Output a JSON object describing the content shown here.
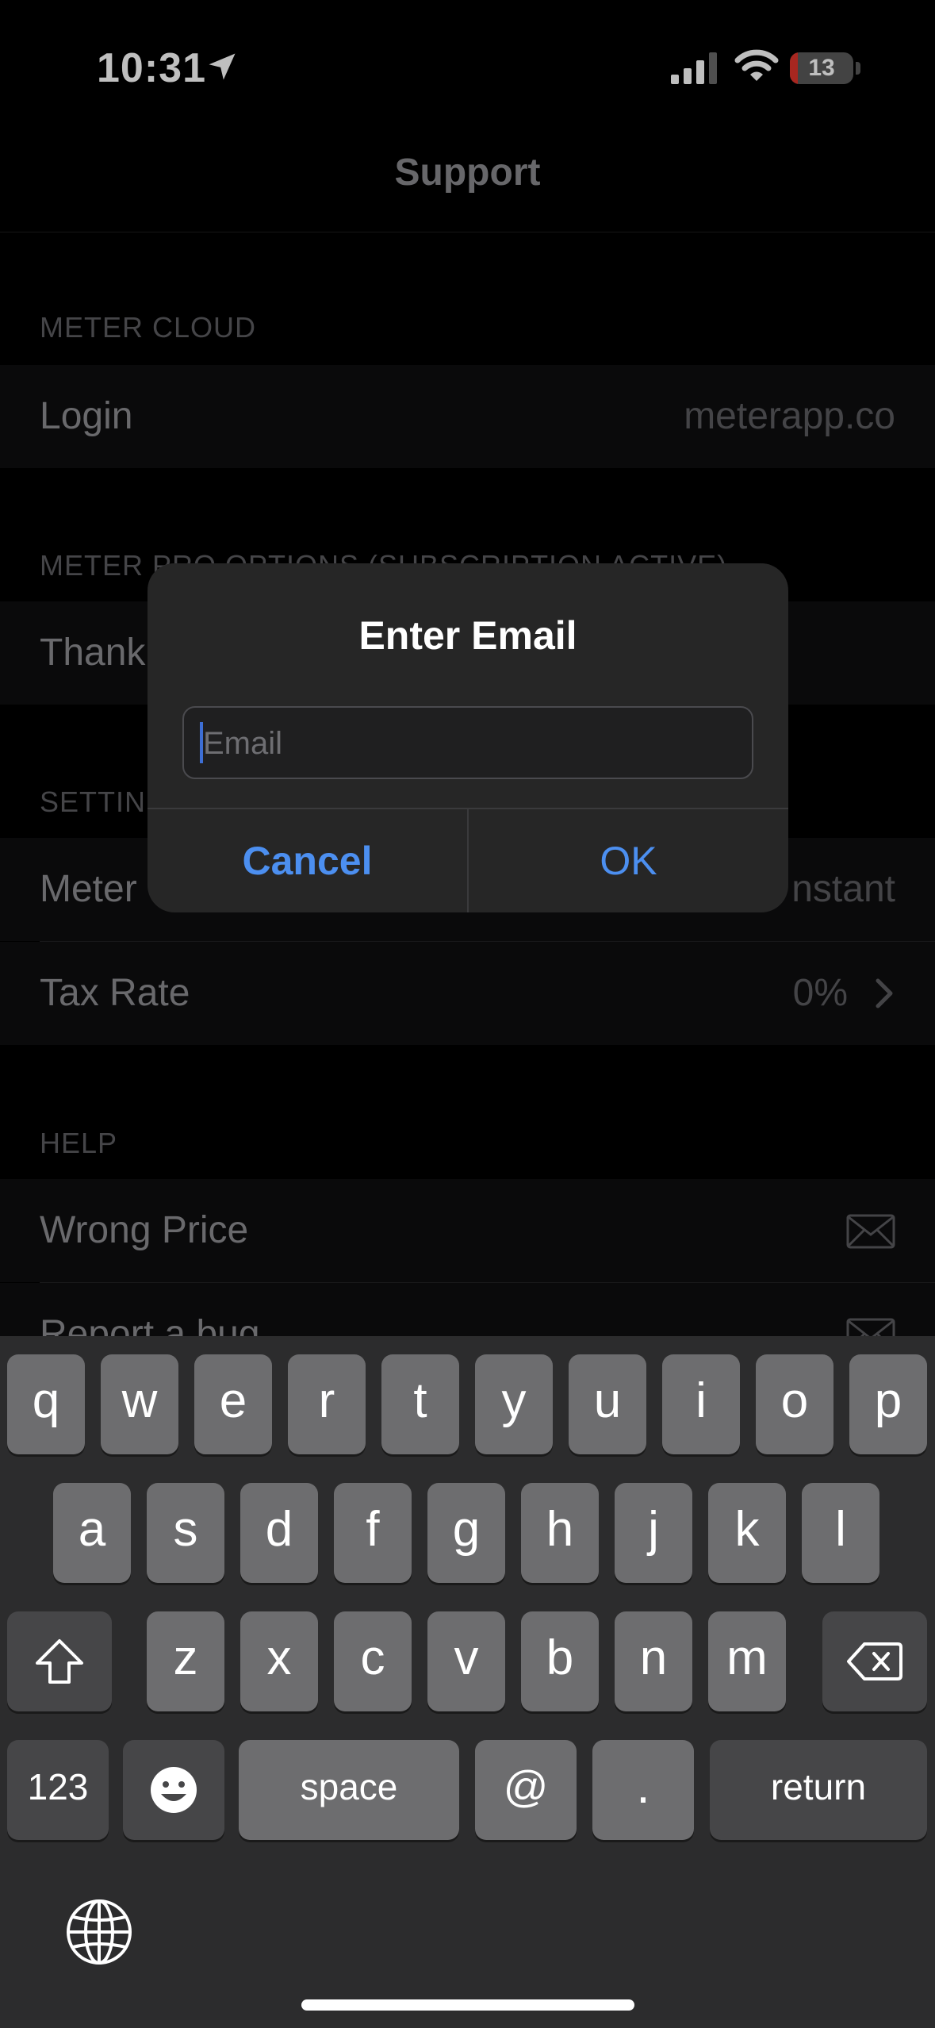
{
  "status_bar": {
    "time": "10:31",
    "battery": "13",
    "battery_level": 0.13
  },
  "nav": {
    "title": "Support"
  },
  "sections": {
    "meter_cloud": {
      "header": "METER CLOUD",
      "login_label": "Login",
      "login_value": "meterapp.co"
    },
    "pro_options": {
      "header": "METER PRO OPTIONS (SUBSCRIPTION ACTIVE)",
      "thank_label": "Thank"
    },
    "settings": {
      "header": "SETTIN",
      "meter_label": "Meter",
      "meter_value": "nstant",
      "tax_label": "Tax Rate",
      "tax_value": "0%"
    },
    "help": {
      "header": "HELP",
      "wrong_price": "Wrong Price",
      "report_bug": "Report a bug"
    }
  },
  "alert": {
    "title": "Enter Email",
    "email_placeholder": "Email",
    "email_value": "",
    "cancel": "Cancel",
    "ok": "OK"
  },
  "keyboard": {
    "row1": [
      "q",
      "w",
      "e",
      "r",
      "t",
      "y",
      "u",
      "i",
      "o",
      "p"
    ],
    "row2": [
      "a",
      "s",
      "d",
      "f",
      "g",
      "h",
      "j",
      "k",
      "l"
    ],
    "row3": [
      "z",
      "x",
      "c",
      "v",
      "b",
      "n",
      "m"
    ],
    "numbers": "123",
    "space": "space",
    "at": "@",
    "dot": ".",
    "return": "return"
  },
  "colors": {
    "accent": "#4c8ff0",
    "battery_low": "#e0352b"
  },
  "icons": [
    "location-arrow-icon",
    "signal-icon",
    "wifi-icon",
    "battery-icon",
    "chevron-right-icon",
    "mail-icon",
    "shift-icon",
    "delete-icon",
    "emoji-icon",
    "globe-icon"
  ]
}
